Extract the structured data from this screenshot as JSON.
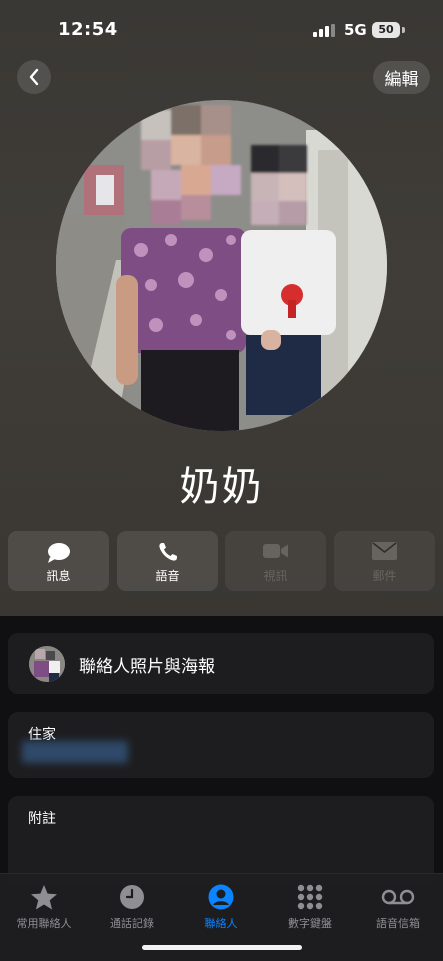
{
  "status_bar": {
    "time": "12:54",
    "network": "5G",
    "battery": "50"
  },
  "nav": {
    "edit_label": "編輯"
  },
  "contact": {
    "name": "奶奶"
  },
  "actions": [
    {
      "label": "訊息",
      "icon": "message-icon",
      "enabled": true
    },
    {
      "label": "語音",
      "icon": "phone-icon",
      "enabled": true
    },
    {
      "label": "視訊",
      "icon": "video-icon",
      "enabled": false
    },
    {
      "label": "郵件",
      "icon": "mail-icon",
      "enabled": false
    }
  ],
  "sections": {
    "photo_poster_label": "聯絡人照片與海報",
    "phone_label": "住家",
    "notes_label": "附註"
  },
  "tabbar": {
    "active_index": 2,
    "tabs": [
      {
        "label": "常用聯絡人",
        "icon": "star-icon"
      },
      {
        "label": "通話記錄",
        "icon": "clock-icon"
      },
      {
        "label": "聯絡人",
        "icon": "person-icon"
      },
      {
        "label": "數字鍵盤",
        "icon": "keypad-icon"
      },
      {
        "label": "語音信箱",
        "icon": "voicemail-icon"
      }
    ]
  },
  "colors": {
    "accent": "#0a84ff",
    "background": "#101012",
    "card": "#1d1d1f"
  }
}
